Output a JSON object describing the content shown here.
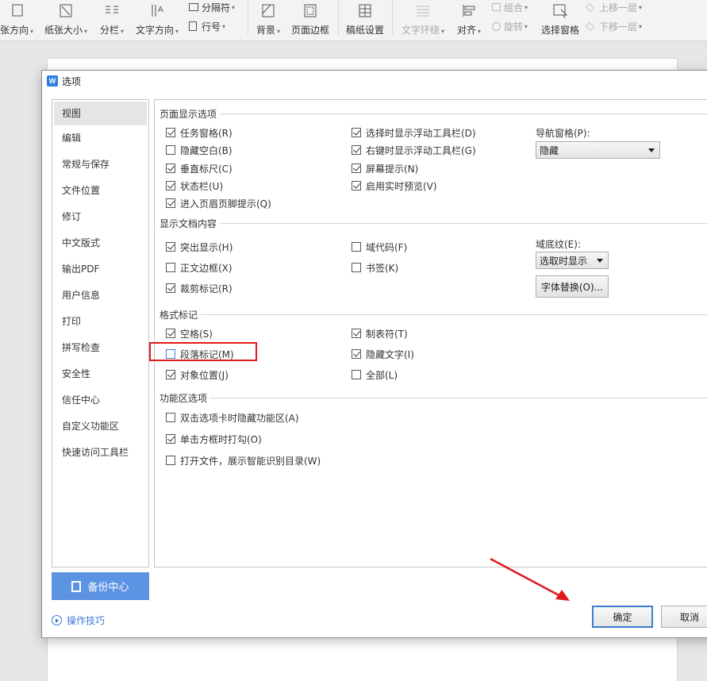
{
  "ribbon": {
    "items": [
      {
        "label": "张方向",
        "icon": "orientation-icon"
      },
      {
        "label": "纸张大小",
        "icon": "paper-size-icon"
      },
      {
        "label": "分栏",
        "icon": "columns-icon"
      },
      {
        "label": "文字方向",
        "icon": "text-direction-icon"
      },
      {
        "label": "背景",
        "icon": "background-icon"
      },
      {
        "label": "页面边框",
        "icon": "page-border-icon"
      },
      {
        "label": "稿纸设置",
        "icon": "draft-paper-icon"
      },
      {
        "label": "文字环绕",
        "icon": "text-wrap-icon"
      },
      {
        "label": "对齐",
        "icon": "align-icon"
      },
      {
        "label": "选择窗格",
        "icon": "selection-pane-icon"
      }
    ],
    "small": {
      "separator": "分隔符",
      "line_number": "行号",
      "group": "组合",
      "rotate": "旋转",
      "bring_forward": "上移一层",
      "send_backward": "下移一层"
    }
  },
  "dialog": {
    "title": "选项",
    "app_icon_letter": "W"
  },
  "nav": {
    "items": [
      {
        "label": "视图",
        "active": true
      },
      {
        "label": "编辑"
      },
      {
        "label": "常规与保存"
      },
      {
        "label": "文件位置"
      },
      {
        "label": "修订"
      },
      {
        "label": "中文版式"
      },
      {
        "label": "输出PDF"
      },
      {
        "label": "用户信息"
      },
      {
        "label": "打印"
      },
      {
        "label": "拼写检查"
      },
      {
        "label": "安全性"
      },
      {
        "label": "信任中心"
      },
      {
        "label": "自定义功能区"
      },
      {
        "label": "快速访问工具栏"
      }
    ]
  },
  "sections": {
    "page_display": {
      "title": "页面显示选项",
      "col1": [
        {
          "label": "任务窗格(R)",
          "checked": true
        },
        {
          "label": "隐藏空白(B)",
          "checked": false
        },
        {
          "label": "垂直标尺(C)",
          "checked": true
        },
        {
          "label": "状态栏(U)",
          "checked": true
        },
        {
          "label": "进入页眉页脚提示(Q)",
          "checked": true
        }
      ],
      "col2": [
        {
          "label": "选择时显示浮动工具栏(D)",
          "checked": true
        },
        {
          "label": "右键时显示浮动工具栏(G)",
          "checked": true
        },
        {
          "label": "屏幕提示(N)",
          "checked": true
        },
        {
          "label": "启用实时预览(V)",
          "checked": true
        }
      ],
      "nav_pane_label": "导航窗格(P):",
      "nav_pane_value": "隐藏"
    },
    "doc_content": {
      "title": "显示文档内容",
      "col1": [
        {
          "label": "突出显示(H)",
          "checked": true
        },
        {
          "label": "正文边框(X)",
          "checked": false
        },
        {
          "label": "裁剪标记(R)",
          "checked": true
        }
      ],
      "col2": [
        {
          "label": "域代码(F)",
          "checked": false
        },
        {
          "label": "书签(K)",
          "checked": false
        }
      ],
      "field_shading_label": "域底纹(E):",
      "field_shading_value": "选取时显示",
      "font_replace_button": "字体替换(O)..."
    },
    "format_marks": {
      "title": "格式标记",
      "col1": [
        {
          "label": "空格(S)",
          "checked": true
        },
        {
          "label": "段落标记(M)",
          "checked": false
        },
        {
          "label": "对象位置(J)",
          "checked": true
        }
      ],
      "col2": [
        {
          "label": "制表符(T)",
          "checked": true
        },
        {
          "label": "隐藏文字(I)",
          "checked": true
        },
        {
          "label": "全部(L)",
          "checked": false
        }
      ]
    },
    "ribbon_options": {
      "title": "功能区选项",
      "items": [
        {
          "label": "双击选项卡时隐藏功能区(A)",
          "checked": false
        },
        {
          "label": "单击方框时打勾(O)",
          "checked": true
        },
        {
          "label": "打开文件，展示智能识别目录(W)",
          "checked": false
        }
      ]
    }
  },
  "footer": {
    "backup_center": "备份中心",
    "tips": "操作技巧",
    "ok": "确定",
    "cancel": "取消"
  },
  "colors": {
    "accent": "#3c7fd0",
    "highlight": "#e0191c",
    "backup_button": "#5d93e3"
  }
}
